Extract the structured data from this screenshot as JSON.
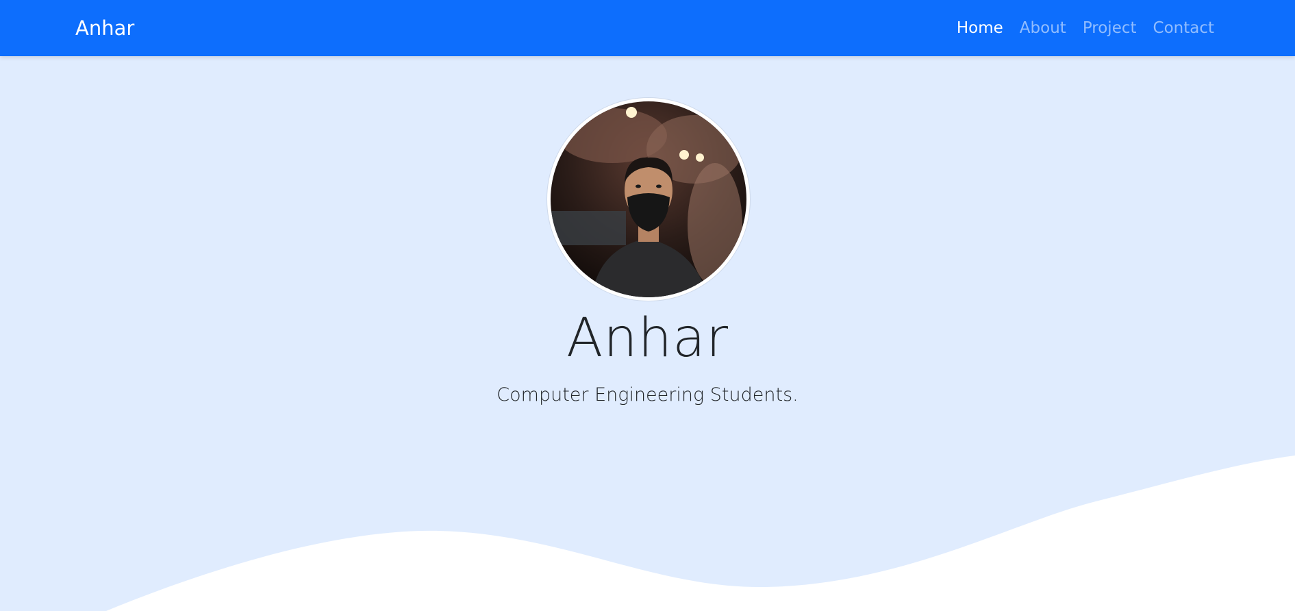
{
  "navbar": {
    "brand": "Anhar",
    "links": [
      {
        "label": "Home",
        "active": true
      },
      {
        "label": "About",
        "active": false
      },
      {
        "label": "Project",
        "active": false
      },
      {
        "label": "Contact",
        "active": false
      }
    ]
  },
  "hero": {
    "name": "Anhar",
    "subtitle": "Computer Engineering Students."
  },
  "colors": {
    "navbar_bg": "#0d6efd",
    "hero_bg": "#e0ecfe",
    "wave_fill": "#ffffff"
  }
}
